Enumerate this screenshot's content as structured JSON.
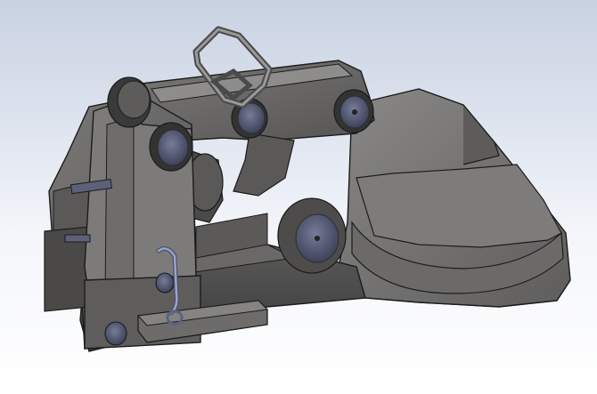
{
  "scene": {
    "colors": {
      "background_top": "#c9d2e2",
      "background_bottom": "#ffffff",
      "body_dark": "#4a4a4a",
      "body_mid": "#6c6b6a",
      "body_light": "#8a8988",
      "edge": "#1c1c1c",
      "pin_face": "#5a5f78",
      "pin_rim": "#2d2d35",
      "handle_wire": "#8d95b4"
    },
    "parts": [
      "top-link-arm",
      "main-frame",
      "front-plate",
      "base-block",
      "curved-jaw-die",
      "lifting-shackle",
      "pivot-pins",
      "lever-handle",
      "safety-pin"
    ]
  }
}
